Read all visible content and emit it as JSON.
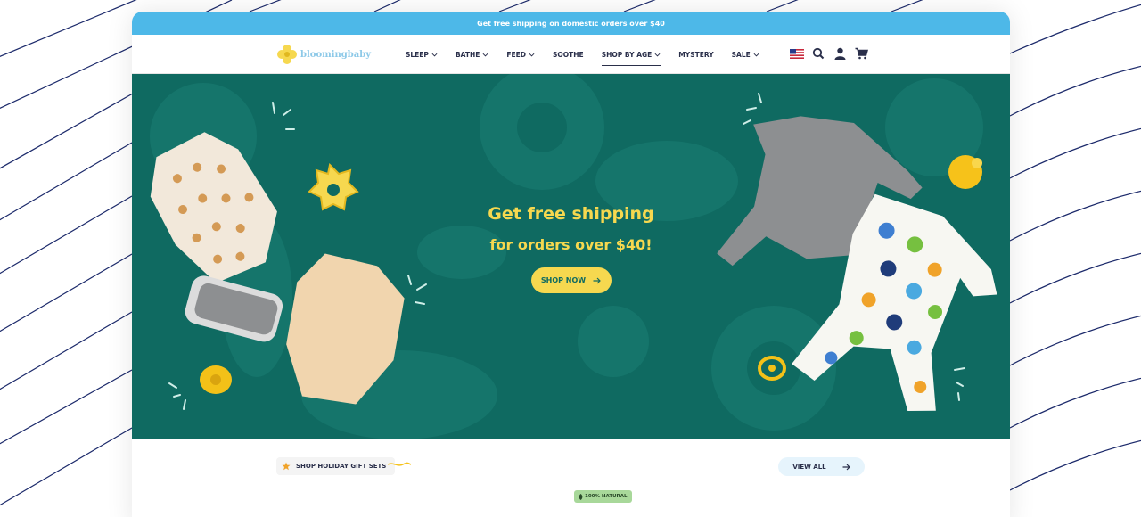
{
  "promo_bar": {
    "text": "Get free shipping on domestic orders over $40"
  },
  "brand": {
    "logo_text": "bloomingbaby"
  },
  "nav": {
    "items": [
      {
        "label": "SLEEP",
        "dropdown": true
      },
      {
        "label": "BATHE",
        "dropdown": true
      },
      {
        "label": "FEED",
        "dropdown": true
      },
      {
        "label": "SOOTHE",
        "dropdown": false
      },
      {
        "label": "SHOP BY AGE",
        "dropdown": true,
        "active": true
      },
      {
        "label": "MYSTERY",
        "dropdown": false
      },
      {
        "label": "SALE",
        "dropdown": true
      }
    ],
    "icons": [
      "us-flag-icon",
      "search-icon",
      "account-icon",
      "cart-icon"
    ]
  },
  "hero": {
    "headline": "Get free shipping",
    "subheadline": "for orders over $40!",
    "cta_label": "SHOP NOW"
  },
  "section": {
    "gift_sets_label": "SHOP HOLIDAY GIFT SETS",
    "view_all_label": "VIEW ALL",
    "badge_label": "100% NATURAL"
  },
  "colors": {
    "promo": "#4db8e8",
    "hero_bg": "#0f6a61",
    "accent_yellow": "#f6d84f",
    "navy": "#2a2f4a",
    "view_all_bg": "#e6f4fc",
    "badge_green": "#a8d89a"
  }
}
